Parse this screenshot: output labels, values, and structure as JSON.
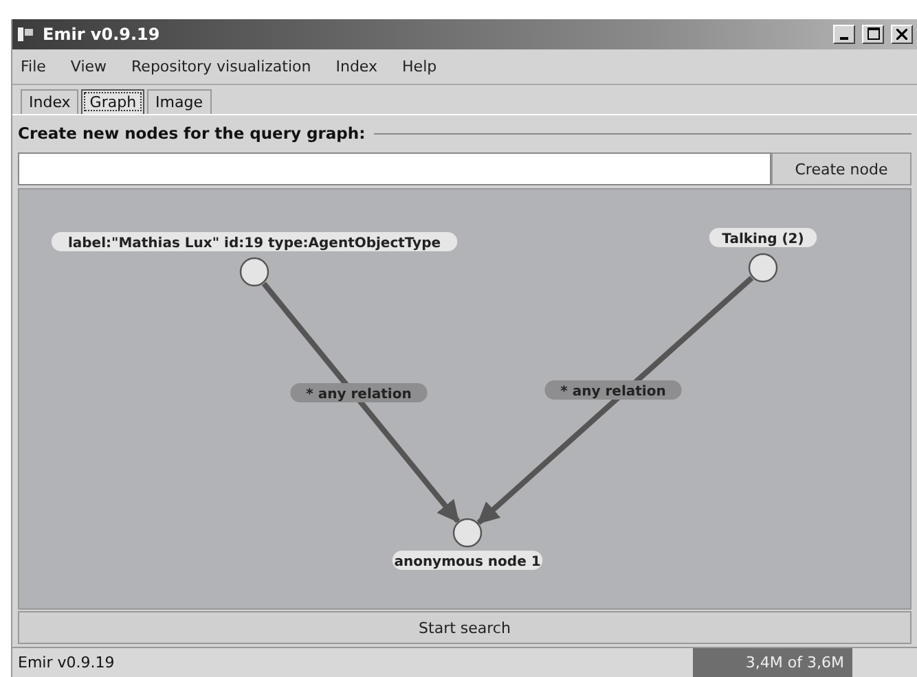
{
  "window": {
    "title": "Emir v0.9.19"
  },
  "menu": [
    "File",
    "View",
    "Repository visualization",
    "Index",
    "Help"
  ],
  "tabs": [
    {
      "label": "Index",
      "selected": false
    },
    {
      "label": "Graph",
      "selected": true
    },
    {
      "label": "Image",
      "selected": false
    }
  ],
  "section_title": "Create new nodes for the query graph:",
  "create_button": "Create node",
  "graph": {
    "nodes": [
      {
        "label": "label:\"Mathias Lux\" id:19 type:AgentObjectType"
      },
      {
        "label": "Talking (2)"
      },
      {
        "label": "anonymous node 1"
      }
    ],
    "edges": [
      {
        "label": "* any relation"
      },
      {
        "label": "* any relation"
      }
    ]
  },
  "search_button": "Start search",
  "status_bar": {
    "text": "Emir v0.9.19",
    "memory": "3,4M of 3,6M"
  }
}
